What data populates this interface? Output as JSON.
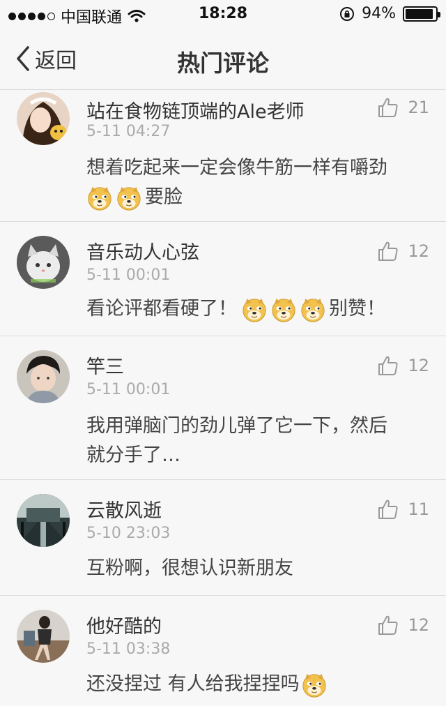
{
  "status_bar": {
    "carrier": "中国联通",
    "time": "18:28",
    "battery": "94%",
    "battery_level": 0.94
  },
  "nav": {
    "back_label": "返回",
    "title": "热门评论"
  },
  "comments": [
    {
      "name": "站在食物链顶端的Ale老师",
      "time": "5-11 04:27",
      "likes": "21",
      "line1": "想着吃起来一定会像牛筋一样有嚼劲",
      "emoji_count": 2,
      "tail": "要脸"
    },
    {
      "name": "音乐动人心弦",
      "time": "5-11 00:01",
      "likes": "12",
      "text": "看论评都看硬了！",
      "emoji_count": 3,
      "tail": "别赞！"
    },
    {
      "name": "竿三",
      "time": "5-11 00:01",
      "likes": "12",
      "line1": "我用弹脑门的劲儿弹了它一下，然后",
      "line2": "就分手了…"
    },
    {
      "name": "云散风逝",
      "time": "5-10 23:03",
      "likes": "11",
      "text": "互粉啊，很想认识新朋友"
    },
    {
      "name": "他好酷的",
      "time": "5-11 03:38",
      "likes": "12",
      "text": "还没捏过 有人给我捏捏吗",
      "emoji_count": 1
    }
  ],
  "icons": {
    "back": "chevron-left-icon",
    "like": "thumbs-up-icon",
    "emoji": "doge-emoji-icon"
  },
  "colors": {
    "background": "#f7f7f7",
    "text": "#333333",
    "muted": "#aaaaaa",
    "divider": "#dcdcdc"
  }
}
